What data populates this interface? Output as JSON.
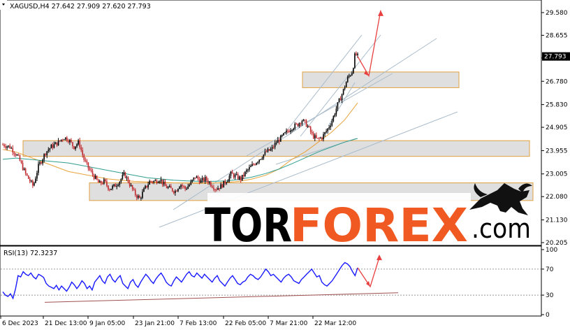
{
  "chart_data": [
    {
      "type": "candlestick",
      "symbol_header": "XAGUSD,H4  27.642 27.909 27.620 27.793",
      "last_price_label": "27.793",
      "y_ticks": [
        "29.580",
        "28.655",
        "27.730",
        "26.780",
        "25.830",
        "24.905",
        "23.955",
        "23.005",
        "22.080",
        "21.130",
        "20.205"
      ],
      "ylim": [
        20.205,
        29.58
      ],
      "x_tick_labels": [
        "6 Dec 2023",
        "21 Dec 13:00",
        "9 Jan 05:00",
        "23 Jan 21:00",
        "7 Feb 13:00",
        "22 Feb 05:00",
        "7 Mar 21:00",
        "22 Mar 12:00"
      ],
      "price_path": [
        [
          0,
          24.2
        ],
        [
          3,
          24.1
        ],
        [
          6,
          23.7
        ],
        [
          9,
          23.0
        ],
        [
          12,
          22.5
        ],
        [
          14,
          23.3
        ],
        [
          17,
          23.9
        ],
        [
          19,
          24.1
        ],
        [
          22,
          24.3
        ],
        [
          24,
          24.5
        ],
        [
          26,
          24.4
        ],
        [
          28,
          24.1
        ],
        [
          30,
          24.3
        ],
        [
          32,
          23.6
        ],
        [
          34,
          23.2
        ],
        [
          36,
          22.9
        ],
        [
          38,
          22.6
        ],
        [
          40,
          22.7
        ],
        [
          42,
          22.4
        ],
        [
          44,
          22.5
        ],
        [
          46,
          22.7
        ],
        [
          48,
          23.0
        ],
        [
          50,
          22.6
        ],
        [
          52,
          22.2
        ],
        [
          54,
          22.0
        ],
        [
          56,
          22.4
        ],
        [
          58,
          22.7
        ],
        [
          60,
          22.7
        ],
        [
          62,
          22.8
        ],
        [
          64,
          22.5
        ],
        [
          66,
          22.4
        ],
        [
          68,
          22.3
        ],
        [
          70,
          22.6
        ],
        [
          72,
          22.4
        ],
        [
          74,
          22.6
        ],
        [
          76,
          22.9
        ],
        [
          78,
          22.7
        ],
        [
          80,
          22.8
        ],
        [
          82,
          22.6
        ],
        [
          84,
          22.4
        ],
        [
          86,
          22.5
        ],
        [
          88,
          22.7
        ],
        [
          90,
          23.0
        ],
        [
          92,
          22.9
        ],
        [
          94,
          22.8
        ],
        [
          96,
          23.1
        ],
        [
          98,
          23.3
        ],
        [
          100,
          23.5
        ],
        [
          102,
          23.7
        ],
        [
          104,
          23.9
        ],
        [
          106,
          24.0
        ],
        [
          108,
          24.3
        ],
        [
          110,
          24.5
        ],
        [
          112,
          24.7
        ],
        [
          114,
          24.9
        ],
        [
          116,
          25.0
        ],
        [
          118,
          25.2
        ],
        [
          120,
          25.0
        ],
        [
          122,
          24.6
        ],
        [
          124,
          24.4
        ],
        [
          126,
          24.5
        ],
        [
          128,
          24.8
        ],
        [
          130,
          25.2
        ],
        [
          132,
          25.8
        ],
        [
          134,
          26.3
        ],
        [
          136,
          26.9
        ],
        [
          138,
          27.2
        ],
        [
          139,
          27.9
        ],
        [
          140,
          27.793
        ]
      ],
      "moving_averages": [
        {
          "color": "#e8a33a",
          "values": [
            24.0,
            23.9,
            23.7,
            23.5,
            23.3,
            23.1,
            23.0,
            22.9,
            22.8,
            22.75,
            22.7,
            22.68,
            22.66,
            22.64,
            22.63,
            22.62,
            22.63,
            22.66,
            22.7,
            22.8,
            22.95,
            23.2,
            23.6,
            23.9,
            24.3,
            24.7,
            25.2,
            25.9
          ]
        },
        {
          "color": "#2e9e8e",
          "values": [
            23.6,
            23.65,
            23.6,
            23.55,
            23.5,
            23.45,
            23.35,
            23.25,
            23.15,
            23.05,
            22.95,
            22.85,
            22.8,
            22.75,
            22.72,
            22.7,
            22.7,
            22.72,
            22.78,
            22.88,
            23.02,
            23.2,
            23.42,
            23.66,
            23.9,
            24.1,
            24.3,
            24.45
          ]
        }
      ],
      "zones": [
        {
          "from": 23.72,
          "to": 24.36
        },
        {
          "from": 21.92,
          "to": 22.64
        },
        {
          "from": 26.52,
          "to": 27.16
        }
      ],
      "forecast": {
        "path": [
          27.793,
          27.0,
          29.67
        ],
        "color": "#e84040"
      }
    },
    {
      "type": "line",
      "title": "RSI(13) 72.3237",
      "y_ticks": [
        "100",
        "70",
        "30",
        "0"
      ],
      "ylim": [
        0,
        100
      ],
      "values": [
        35,
        30,
        28,
        32,
        25,
        40,
        60,
        58,
        66,
        62,
        60,
        64,
        58,
        55,
        62,
        60,
        57,
        48,
        44,
        42,
        40,
        45,
        38,
        44,
        40,
        36,
        42,
        50,
        46,
        40,
        45,
        52,
        48,
        40,
        44,
        38,
        50,
        55,
        60,
        52,
        48,
        58,
        62,
        54,
        50,
        56,
        60,
        48,
        44,
        40,
        50,
        54,
        46,
        42,
        50,
        56,
        62,
        58,
        52,
        48,
        55,
        60,
        64,
        58,
        50,
        46,
        44,
        52,
        58,
        54,
        50,
        56,
        62,
        66,
        60,
        58,
        64,
        60,
        56,
        62,
        58,
        54,
        50,
        56,
        60,
        52,
        48,
        44,
        50,
        56,
        60,
        54,
        48,
        46,
        50,
        52,
        58,
        62,
        60,
        56,
        54,
        58,
        64,
        70,
        66,
        60,
        62,
        58,
        54,
        50,
        56,
        60,
        62,
        58,
        52,
        50,
        48,
        54,
        58,
        62,
        66,
        70,
        64,
        58,
        60,
        50,
        46,
        44,
        48,
        52,
        58,
        64,
        70,
        76,
        80,
        78,
        74,
        66,
        60,
        72
      ],
      "support": [
        34,
        39
      ],
      "forecast": {
        "path": [
          72,
          43,
          88
        ],
        "color": "#e84040"
      }
    }
  ],
  "branding": {
    "tor": "TOR",
    "forex": "FOREX",
    "com": ".com",
    "logo": "bull-head-logo"
  },
  "colors": {
    "candle_up": "#000000",
    "candle_down": "#c0262b",
    "rsi": "#1a1aff",
    "zone_fill": "#d9d9d9",
    "zone_border": "#e0a040",
    "channel": "#aabccb"
  }
}
